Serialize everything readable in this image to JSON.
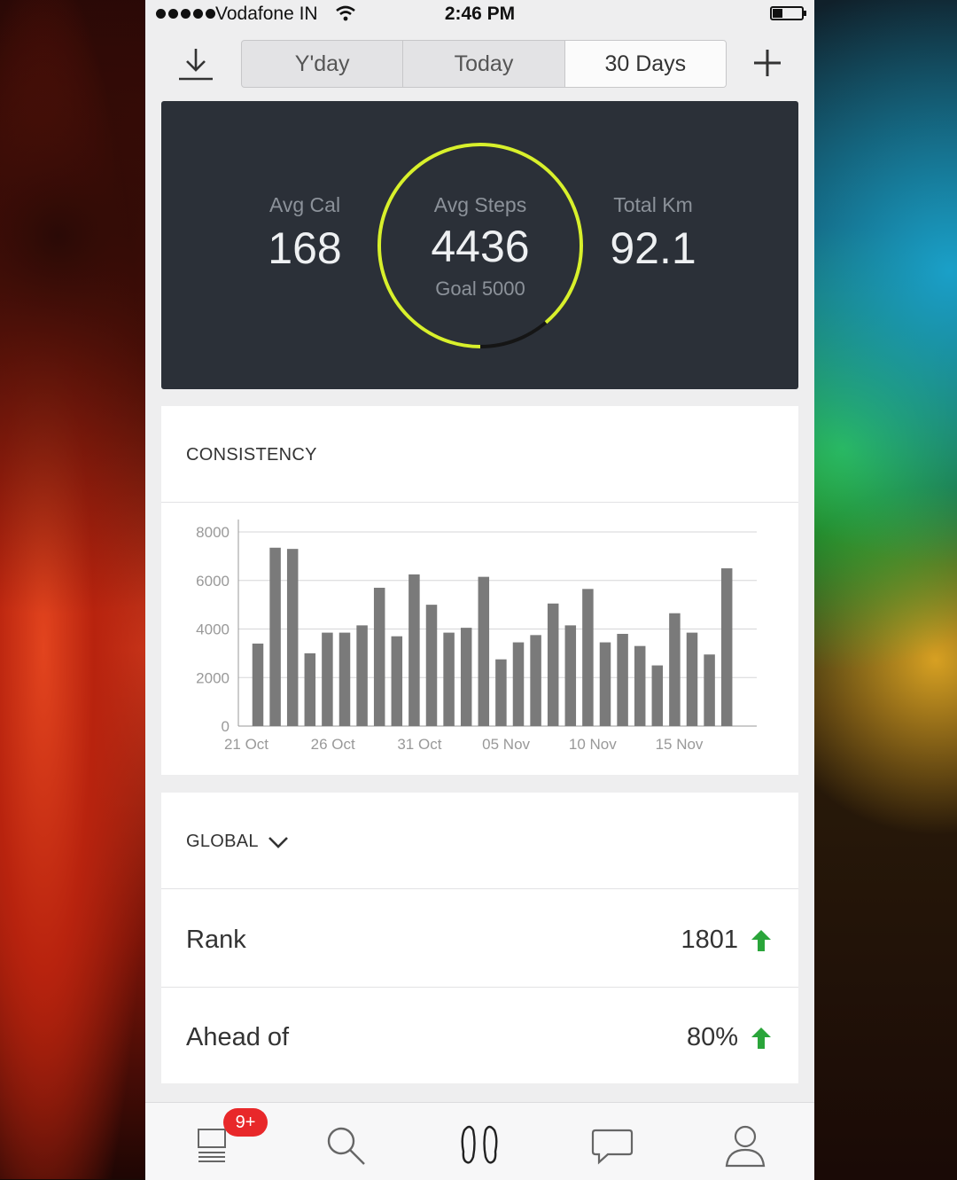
{
  "status_bar": {
    "carrier": "Vodafone IN",
    "time": "2:46 PM",
    "battery_level": 0.3
  },
  "toolbar": {
    "left_icon": "download-icon",
    "right_icon": "plus-icon",
    "tabs": [
      {
        "label": "Y'day",
        "selected": false
      },
      {
        "label": "Today",
        "selected": false
      },
      {
        "label": "30 Days",
        "selected": true
      }
    ]
  },
  "summary": {
    "avg_cal_label": "Avg Cal",
    "avg_cal_value": "168",
    "avg_steps_label": "Avg Steps",
    "avg_steps_value": "4436",
    "goal_text": "Goal 5000",
    "goal_progress": 0.8872,
    "total_km_label": "Total Km",
    "total_km_value": "92.1",
    "colors": {
      "ring": "#d8f02c",
      "ring_track": "#111111",
      "background": "#2b3038"
    }
  },
  "consistency": {
    "title": "CONSISTENCY"
  },
  "chart_data": {
    "type": "bar",
    "title": "",
    "xlabel": "",
    "ylabel": "",
    "ylim": [
      0,
      8000
    ],
    "yticks": [
      0,
      2000,
      4000,
      6000,
      8000
    ],
    "xtick_labels": [
      "21 Oct",
      "26 Oct",
      "31 Oct",
      "05 Nov",
      "10 Nov",
      "15 Nov"
    ],
    "grid": true,
    "bar_color": "#7a7a7a",
    "categories": [
      "20 Oct",
      "21 Oct",
      "22 Oct",
      "23 Oct",
      "24 Oct",
      "25 Oct",
      "26 Oct",
      "27 Oct",
      "28 Oct",
      "29 Oct",
      "30 Oct",
      "31 Oct",
      "01 Nov",
      "02 Nov",
      "03 Nov",
      "04 Nov",
      "05 Nov",
      "06 Nov",
      "07 Nov",
      "08 Nov",
      "09 Nov",
      "10 Nov",
      "11 Nov",
      "12 Nov",
      "13 Nov",
      "14 Nov",
      "15 Nov",
      "16 Nov",
      "17 Nov",
      "18 Nov"
    ],
    "values": [
      3400,
      7350,
      7300,
      3000,
      3850,
      3850,
      4150,
      5700,
      3700,
      6250,
      5000,
      3850,
      4050,
      6150,
      2750,
      3450,
      3750,
      5050,
      4150,
      5650,
      3450,
      3800,
      3300,
      2500,
      4650,
      3850,
      2950,
      6500
    ]
  },
  "global": {
    "title": "GLOBAL",
    "rows": [
      {
        "label": "Rank",
        "value": "1801",
        "trend": "up"
      },
      {
        "label": "Ahead of",
        "value": "80%",
        "trend": "up"
      }
    ],
    "trend_color": "#2aa53a"
  },
  "tabbar": {
    "badge": "9+",
    "items": [
      "feed-icon",
      "search-icon",
      "footsteps-icon",
      "chat-icon",
      "profile-icon"
    ]
  }
}
